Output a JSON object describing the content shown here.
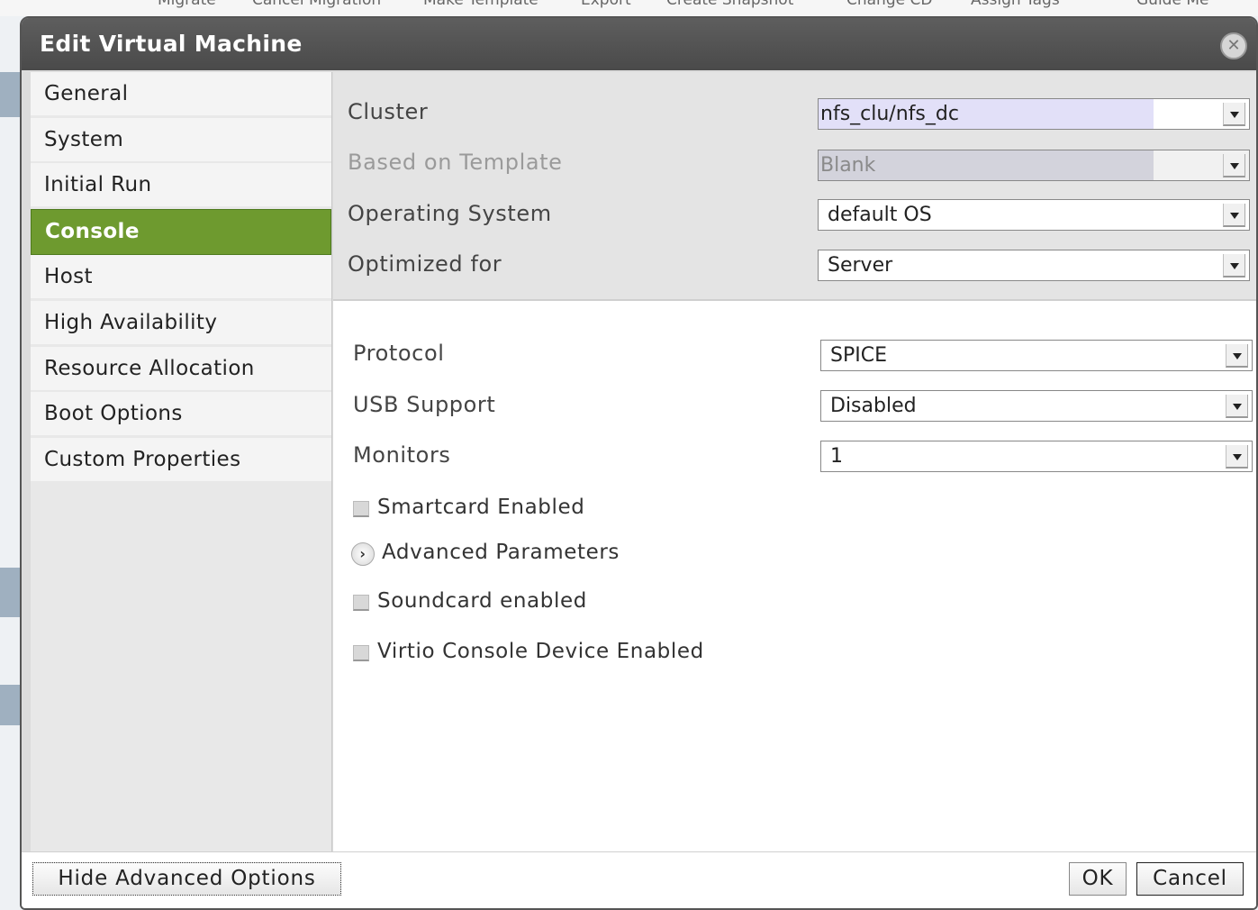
{
  "background": {
    "toolbar_items": [
      "Migrate",
      "Cancel Migration",
      "Make Template",
      "Export",
      "Create Snapshot",
      "Change CD",
      "Assign Tags",
      "Guide Me"
    ]
  },
  "dialog": {
    "title": "Edit Virtual Machine",
    "close_icon": "close-circle-icon"
  },
  "sidebar": {
    "items": [
      {
        "label": "General",
        "active": false
      },
      {
        "label": "System",
        "active": false
      },
      {
        "label": "Initial Run",
        "active": false
      },
      {
        "label": "Console",
        "active": true
      },
      {
        "label": "Host",
        "active": false
      },
      {
        "label": "High Availability",
        "active": false
      },
      {
        "label": "Resource Allocation",
        "active": false
      },
      {
        "label": "Boot Options",
        "active": false
      },
      {
        "label": "Custom Properties",
        "active": false
      }
    ]
  },
  "general": {
    "cluster": {
      "label": "Cluster",
      "value": "nfs_clu/nfs_dc"
    },
    "template": {
      "label": "Based on Template",
      "value": "Blank",
      "disabled": true
    },
    "os": {
      "label": "Operating System",
      "value": "default OS"
    },
    "optimized": {
      "label": "Optimized for",
      "value": "Server"
    }
  },
  "console": {
    "protocol": {
      "label": "Protocol",
      "value": "SPICE"
    },
    "usb": {
      "label": "USB Support",
      "value": "Disabled"
    },
    "monitors": {
      "label": "Monitors",
      "value": "1"
    },
    "smartcard": {
      "label": "Smartcard Enabled",
      "checked": false
    },
    "advanced": {
      "label": "Advanced Parameters",
      "icon": "chevron-right-icon"
    },
    "soundcard": {
      "label": "Soundcard enabled",
      "checked": false
    },
    "virtio": {
      "label": "Virtio Console Device Enabled",
      "checked": false
    }
  },
  "footer": {
    "hide_advanced": "Hide Advanced Options",
    "ok": "OK",
    "cancel": "Cancel"
  },
  "colors": {
    "active_nav": "#6e9a2f",
    "titlebar": "#4f4f4f"
  }
}
